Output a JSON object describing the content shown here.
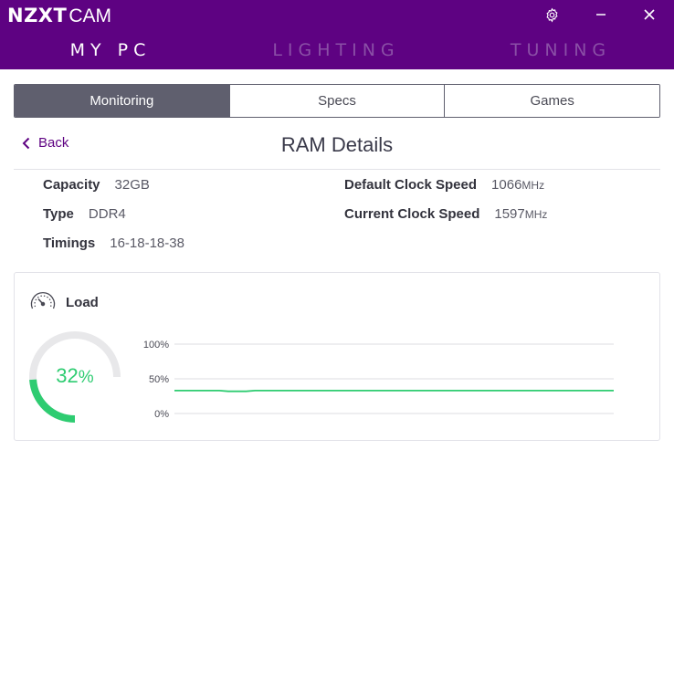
{
  "app": {
    "brand": "NZXT",
    "product": "CAM"
  },
  "window_controls": {
    "settings_icon": "gear-icon",
    "minimize_icon": "minimize-icon",
    "close_icon": "close-icon"
  },
  "nav": {
    "items": [
      {
        "label": "MY PC",
        "active": true
      },
      {
        "label": "LIGHTING",
        "active": false
      },
      {
        "label": "TUNING",
        "active": false
      }
    ]
  },
  "tabs": [
    {
      "label": "Monitoring",
      "active": true
    },
    {
      "label": "Specs",
      "active": false
    },
    {
      "label": "Games",
      "active": false
    }
  ],
  "back": {
    "label": "Back",
    "icon": "chevron-left-icon"
  },
  "page_title": "RAM Details",
  "specs": {
    "capacity": {
      "label": "Capacity",
      "value": "32GB"
    },
    "type": {
      "label": "Type",
      "value": "DDR4"
    },
    "timings": {
      "label": "Timings",
      "value": "16-18-18-38"
    },
    "default_clock": {
      "label": "Default Clock Speed",
      "value": "1066",
      "unit": "MHz"
    },
    "current_clock": {
      "label": "Current Clock Speed",
      "value": "1597",
      "unit": "MHz"
    }
  },
  "load": {
    "title": "Load",
    "icon": "speedometer-icon",
    "value": "32",
    "unit": "%",
    "fraction": 0.32,
    "accent_color": "#2ecc71",
    "track_color": "#e8e8ea"
  },
  "chart_data": {
    "type": "line",
    "y_ticks": [
      "100%",
      "50%",
      "0%"
    ],
    "ylim": [
      0,
      100
    ],
    "series": [
      {
        "values": [
          33,
          33,
          33,
          33,
          33,
          33,
          32,
          32,
          32,
          33,
          33,
          33,
          33,
          33,
          33,
          33,
          33,
          33,
          33,
          33,
          33,
          33,
          33,
          33,
          33,
          33,
          33,
          33,
          33,
          33,
          33,
          33,
          33,
          33,
          33,
          33,
          33,
          33,
          33,
          33,
          33,
          33,
          33,
          33,
          33,
          33,
          33,
          33,
          33,
          33
        ]
      }
    ],
    "line_color": "#2ecc71",
    "grid": true
  }
}
